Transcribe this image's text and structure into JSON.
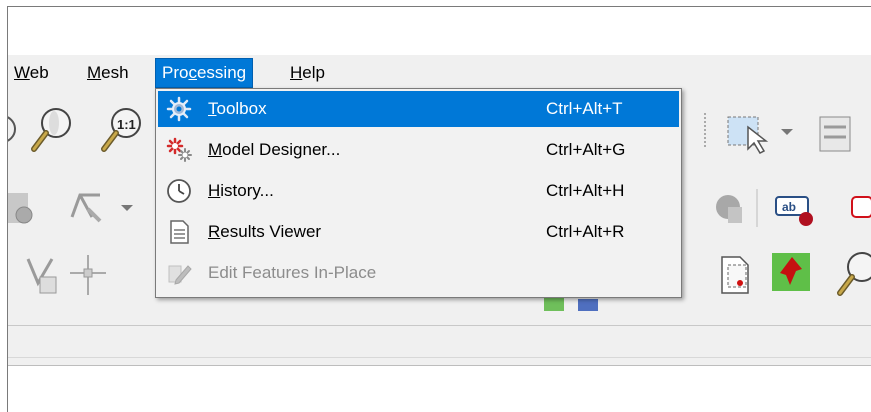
{
  "menubar": {
    "items": [
      {
        "id": "web",
        "pre": "",
        "key": "W",
        "post": "eb"
      },
      {
        "id": "mesh",
        "pre": "",
        "key": "M",
        "post": "esh"
      },
      {
        "id": "processing",
        "pre": "Pro",
        "key": "c",
        "post": "essing"
      },
      {
        "id": "help",
        "pre": "",
        "key": "H",
        "post": "elp"
      }
    ]
  },
  "processing_menu": {
    "items": [
      {
        "pre": "",
        "key": "T",
        "post": "oolbox",
        "shortcut": "Ctrl+Alt+T",
        "icon": "gear-icon",
        "state": "highlighted"
      },
      {
        "pre": "",
        "key": "M",
        "post": "odel Designer...",
        "shortcut": "Ctrl+Alt+G",
        "icon": "model-designer-icon",
        "state": "normal"
      },
      {
        "pre": "",
        "key": "H",
        "post": "istory...",
        "shortcut": "Ctrl+Alt+H",
        "icon": "clock-icon",
        "state": "normal"
      },
      {
        "pre": "",
        "key": "R",
        "post": "esults Viewer",
        "shortcut": "Ctrl+Alt+R",
        "icon": "document-icon",
        "state": "normal"
      },
      {
        "pre": "Edit Features In-Place",
        "key": "",
        "post": "",
        "shortcut": "",
        "icon": "edit-in-place-icon",
        "state": "disabled"
      }
    ]
  },
  "toolbar_icons": [
    "zoom-in-icon",
    "zoom-native-icon",
    "select-feature-icon",
    "attribute-table-icon",
    "digitize-icon",
    "snap-icon",
    "render-3d-icon",
    "label-icon",
    "vertex-tool-icon",
    "node-tool-icon",
    "identify-feature-icon",
    "add-pin-icon",
    "identify-icon"
  ],
  "colors": {
    "highlight": "#0078d7",
    "menu_bg": "#f2f2f2",
    "toolbar_bg": "#f0f0f0"
  }
}
